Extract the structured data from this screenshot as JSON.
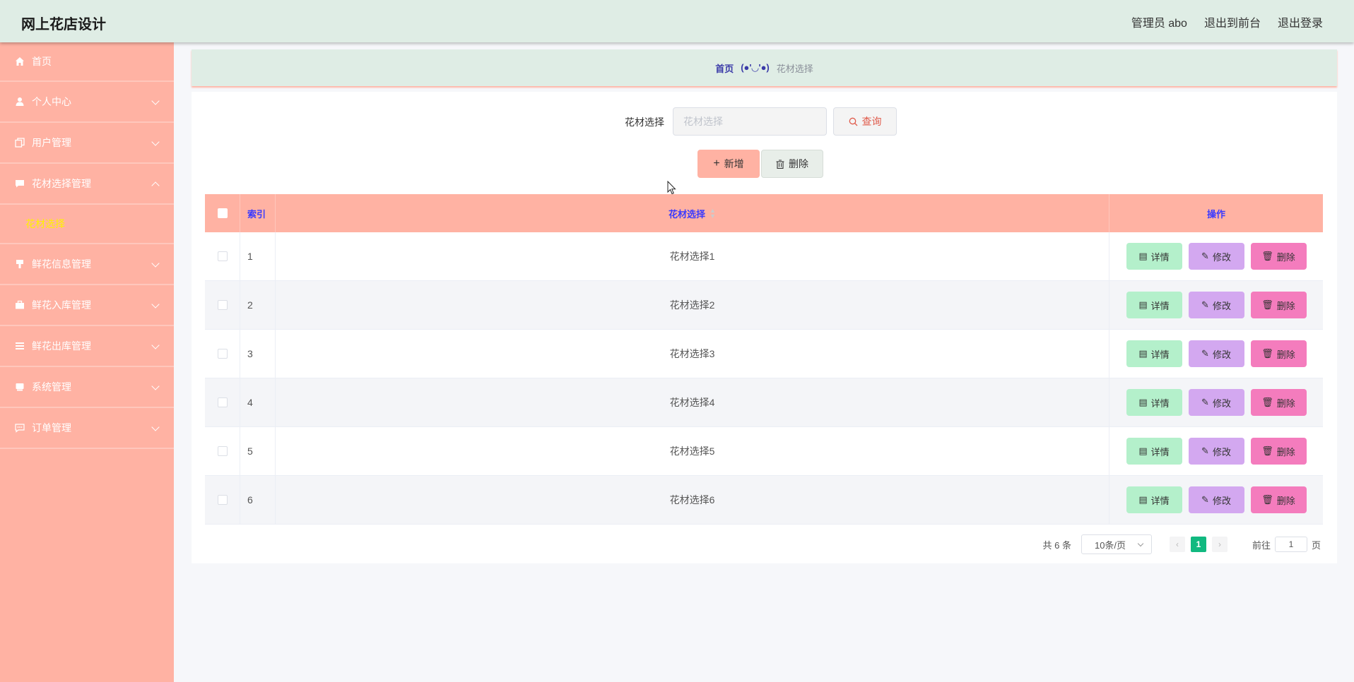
{
  "header": {
    "title": "网上花店设计",
    "user": "管理员 abo",
    "to_front": "退出到前台",
    "logout": "退出登录"
  },
  "sidebar": {
    "items": [
      {
        "label": "首页",
        "icon": "home-icon"
      },
      {
        "label": "个人中心",
        "icon": "user-icon"
      },
      {
        "label": "用户管理",
        "icon": "copy-icon"
      },
      {
        "label": "花材选择管理",
        "icon": "chat-icon",
        "expanded": true,
        "children": [
          "花材选择"
        ]
      },
      {
        "label": "鲜花信息管理",
        "icon": "brush-icon"
      },
      {
        "label": "鲜花入库管理",
        "icon": "briefcase-icon"
      },
      {
        "label": "鲜花出库管理",
        "icon": "list-icon"
      },
      {
        "label": "系统管理",
        "icon": "box-icon"
      },
      {
        "label": "订单管理",
        "icon": "message-icon"
      }
    ]
  },
  "breadcrumb": {
    "home": "首页",
    "face": "(●'◡'●)",
    "current": "花材选择"
  },
  "search": {
    "label": "花材选择",
    "placeholder": "花材选择",
    "query_label": "查询"
  },
  "actions": {
    "add_label": "新增",
    "delete_label": "删除"
  },
  "table": {
    "headers": {
      "index": "索引",
      "name": "花材选择",
      "ops": "操作"
    },
    "rows": [
      {
        "index": "1",
        "name": "花材选择1"
      },
      {
        "index": "2",
        "name": "花材选择2"
      },
      {
        "index": "3",
        "name": "花材选择3"
      },
      {
        "index": "4",
        "name": "花材选择4"
      },
      {
        "index": "5",
        "name": "花材选择5"
      },
      {
        "index": "6",
        "name": "花材选择6"
      }
    ],
    "op_labels": {
      "detail": "详情",
      "edit": "修改",
      "remove": "删除"
    }
  },
  "pagination": {
    "total": "共 6 条",
    "page_size": "10条/页",
    "current_page": "1",
    "goto_prefix": "前往",
    "goto_value": "1",
    "goto_suffix": "页"
  },
  "colors": {
    "header_bg": "#dfede5",
    "sidebar_bg": "#ffb2a3",
    "active_sub": "#fff200",
    "detail_btn": "#b4f0cb",
    "edit_btn": "#d3a8f0",
    "remove_btn": "#f47cbd",
    "page_active": "#11b980"
  }
}
